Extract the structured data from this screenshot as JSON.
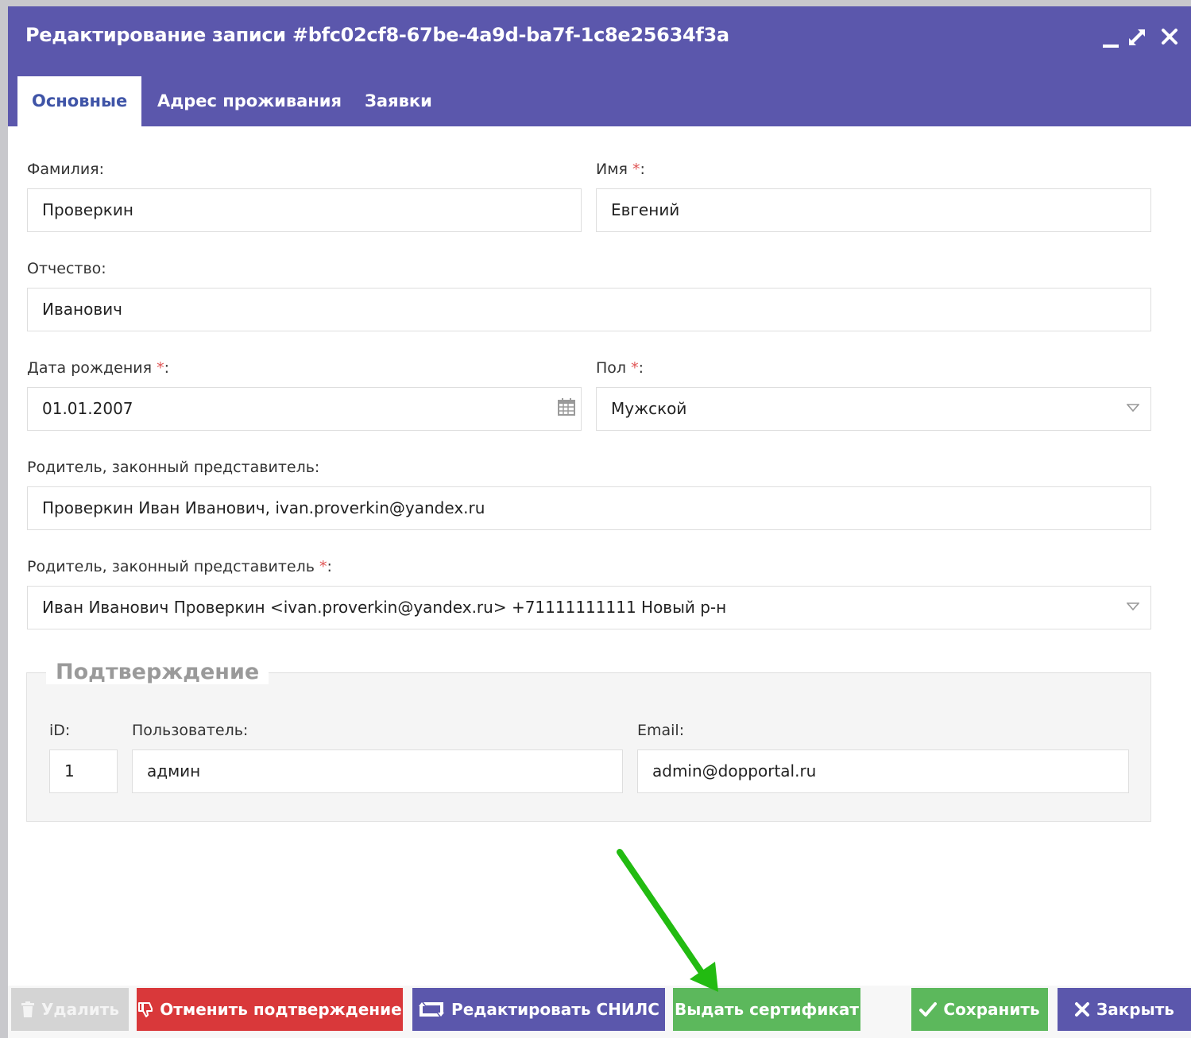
{
  "window": {
    "title": "Редактирование записи #bfc02cf8-67be-4a9d-ba7f-1c8e25634f3a",
    "controls": {
      "minimize": "minimize-icon",
      "maximize": "maximize-icon",
      "close": "close-icon"
    }
  },
  "tabs": [
    {
      "label": "Основные",
      "active": true
    },
    {
      "label": "Адрес проживания",
      "active": false
    },
    {
      "label": "Заявки",
      "active": false
    }
  ],
  "form": {
    "last_name": {
      "label": "Фамилия:",
      "value": "Проверкин"
    },
    "first_name": {
      "label": "Имя",
      "required": "*",
      "suffix": ":",
      "value": "Евгений"
    },
    "patronymic": {
      "label": "Отчество:",
      "value": "Иванович"
    },
    "birth_date": {
      "label": "Дата рождения",
      "required": "*",
      "suffix": ":",
      "value": "01.01.2007"
    },
    "gender": {
      "label": "Пол",
      "required": "*",
      "suffix": ":",
      "value": "Мужской"
    },
    "guardian_text": {
      "label": "Родитель, законный представитель:",
      "value": "Проверкин Иван Иванович, ivan.proverkin@yandex.ru"
    },
    "guardian_select": {
      "label": "Родитель, законный представитель",
      "required": "*",
      "suffix": ":",
      "value": "Иван Иванович Проверкин <ivan.proverkin@yandex.ru> +71111111111 Новый р-н"
    }
  },
  "confirmation": {
    "legend": "Подтверждение",
    "id": {
      "label": "iD:",
      "value": "1"
    },
    "user": {
      "label": "Пользователь:",
      "value": "админ"
    },
    "email": {
      "label": "Email:",
      "value": "admin@dopportal.ru"
    }
  },
  "buttons": {
    "delete": "Удалить",
    "cancel_confirmation": "Отменить подтверждение",
    "edit_snils": "Редактировать СНИЛС",
    "issue_certificate": "Выдать сертификат",
    "save": "Сохранить",
    "close": "Закрыть"
  },
  "colors": {
    "header": "#5b57ac",
    "active_tab_text": "#3f54a7",
    "delete_btn": "#d4d4d4",
    "cancel_btn": "#d9383a",
    "snils_btn": "#5b57ac",
    "certificate_btn": "#5cb85c",
    "save_btn": "#5cb85c",
    "close_btn": "#5b57ac",
    "arrow": "#22bb11"
  }
}
